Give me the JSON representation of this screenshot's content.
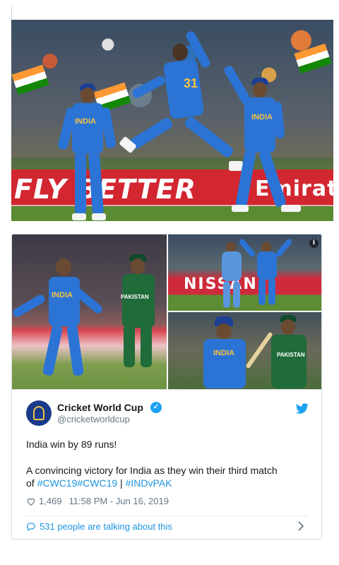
{
  "hero_photo": {
    "hoarding_left": "FLY BETTER",
    "hoarding_right": "Emirates",
    "jersey_number": "31",
    "jersey_name": "INDIA"
  },
  "tweet": {
    "media_panels": {
      "left_jersey": "INDIA",
      "left_opponent_jersey": "PAKISTAN",
      "tr_hoarding": "NISSAN",
      "br_jersey": "INDIA",
      "br_opponent_jersey": "PAKISTAN"
    },
    "display_name": "Cricket World Cup",
    "handle": "@cricketworldcup",
    "line1": "India win by 89 runs!",
    "line2": "A convincing victory for India as they win their third match",
    "line3_prefix": "of ",
    "hashtag1": "#CWC19",
    "hashtag2": "#CWC19",
    "separator": " | ",
    "hashtag3": "#INDvPAK",
    "likes": "1,469",
    "timestamp": "11:58 PM - Jun 16, 2019",
    "talking": "531 people are talking about this"
  },
  "colors": {
    "link": "#1b95e0",
    "verified": "#1da1f2",
    "india_blue": "#2b74d6",
    "pakistan_green": "#1f6b3a"
  },
  "icons": [
    "heart-icon",
    "twitter-bird-icon",
    "verified-badge-icon",
    "comment-bubble-icon",
    "chevron-right-icon",
    "info-icon"
  ]
}
